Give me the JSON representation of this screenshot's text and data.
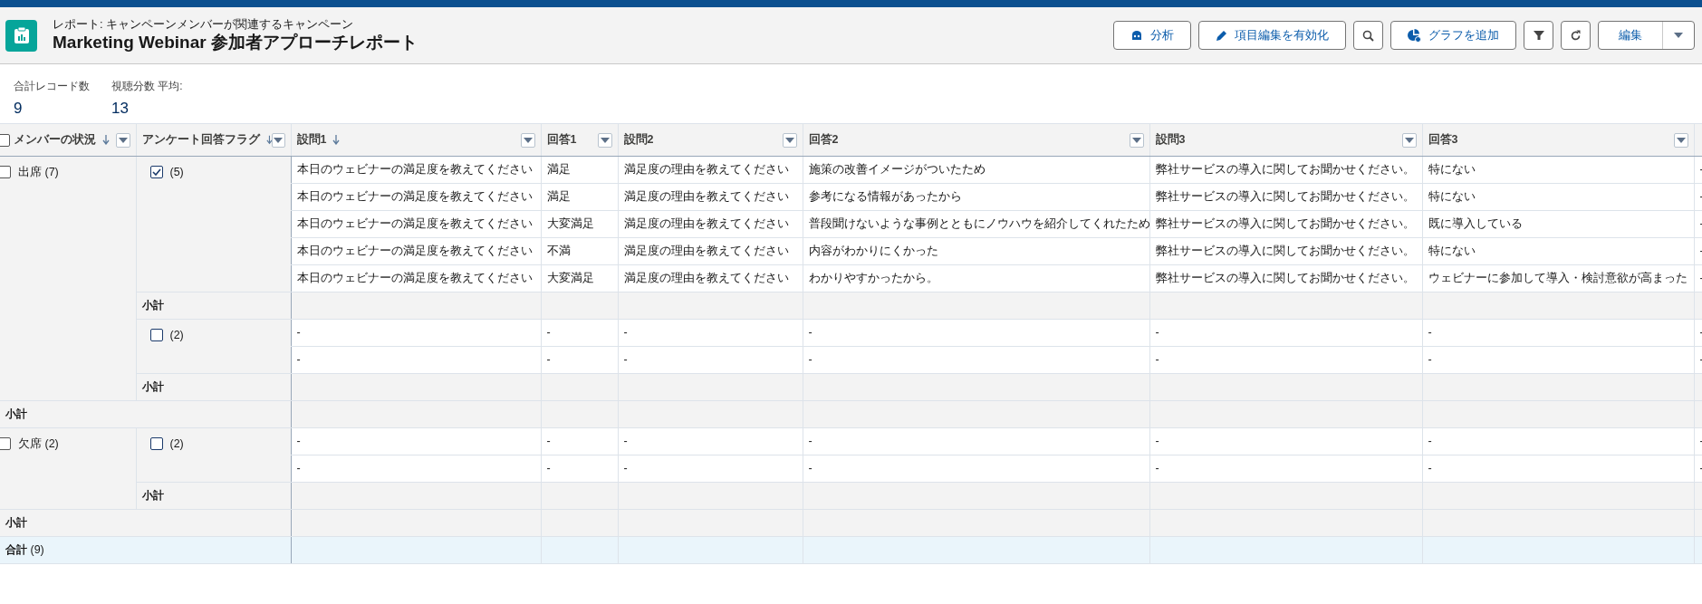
{
  "header": {
    "subtitle": "レポート: キャンペーンメンバーが関連するキャンペーン",
    "title": "Marketing Webinar 参加者アプローチレポート",
    "buttons": [
      {
        "kind": "analyze",
        "label": "分析"
      },
      {
        "kind": "edit-fields",
        "label": "項目編集を有効化"
      },
      {
        "kind": "search"
      },
      {
        "kind": "add-chart",
        "label": "グラフを追加"
      },
      {
        "kind": "filter"
      },
      {
        "kind": "refresh"
      },
      {
        "kind": "split",
        "label": "編集"
      }
    ]
  },
  "stats": [
    {
      "label": "合計レコード数",
      "value": "9"
    },
    {
      "label": "視聴分数 平均:",
      "value": "13"
    }
  ],
  "table": {
    "columns": [
      {
        "label": "メンバーの状況",
        "sorted": true,
        "checked": false
      },
      {
        "label": "アンケート回答フラグ",
        "sorted": true
      },
      {
        "label": "設問1",
        "sorted": true
      },
      {
        "label": "回答1",
        "sorted": false
      },
      {
        "label": "設問2",
        "sorted": false
      },
      {
        "label": "回答2",
        "sorted": false
      },
      {
        "label": "設問3",
        "sorted": false
      },
      {
        "label": "回答3",
        "sorted": false
      }
    ],
    "groups": [
      {
        "label": "出席",
        "count": "(7)",
        "checked": false,
        "subtotal": "小計",
        "flags": [
          {
            "checked": true,
            "count": "(5)",
            "subtotal": "小計",
            "rows": [
              [
                "本日のウェビナーの満足度を教えてください",
                "満足",
                "満足度の理由を教えてください",
                "施策の改善イメージがついたため",
                "弊社サービスの導入に関してお聞かせください。",
                "特にない",
                "-"
              ],
              [
                "本日のウェビナーの満足度を教えてください",
                "満足",
                "満足度の理由を教えてください",
                "参考になる情報があったから",
                "弊社サービスの導入に関してお聞かせください。",
                "特にない",
                "-"
              ],
              [
                "本日のウェビナーの満足度を教えてください",
                "大変満足",
                "満足度の理由を教えてください",
                "普段聞けないような事例とともにノウハウを紹介してくれたため",
                "弊社サービスの導入に関してお聞かせください。",
                "既に導入している",
                "-"
              ],
              [
                "本日のウェビナーの満足度を教えてください",
                "不満",
                "満足度の理由を教えてください",
                "内容がわかりにくかった",
                "弊社サービスの導入に関してお聞かせください。",
                "特にない",
                "-"
              ],
              [
                "本日のウェビナーの満足度を教えてください",
                "大変満足",
                "満足度の理由を教えてください",
                "わかりやすかったから。",
                "弊社サービスの導入に関してお聞かせください。",
                "ウェビナーに参加して導入・検討意欲が高まった",
                "-"
              ]
            ]
          },
          {
            "checked": false,
            "count": "(2)",
            "subtotal": "小計",
            "rows": [
              [
                "-",
                "-",
                "-",
                "-",
                "-",
                "-",
                "-"
              ],
              [
                "-",
                "-",
                "-",
                "-",
                "-",
                "-",
                "-"
              ]
            ]
          }
        ]
      },
      {
        "label": "欠席",
        "count": "(2)",
        "checked": false,
        "subtotal": "小計",
        "flags": [
          {
            "checked": false,
            "count": "(2)",
            "subtotal": "小計",
            "rows": [
              [
                "-",
                "-",
                "-",
                "-",
                "-",
                "-",
                "-"
              ],
              [
                "-",
                "-",
                "-",
                "-",
                "-",
                "-",
                "-"
              ]
            ]
          }
        ]
      }
    ],
    "total": {
      "label": "合計",
      "count": "(9)"
    }
  }
}
